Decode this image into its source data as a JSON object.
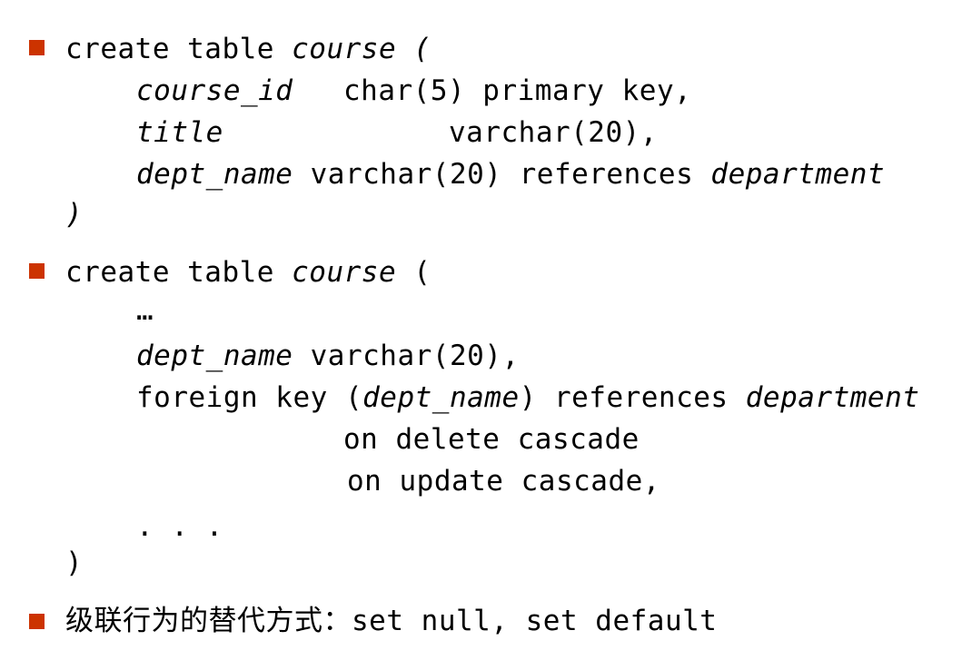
{
  "colors": {
    "bullet": "#cc3300",
    "text": "#000000"
  },
  "block1": {
    "kw": "create table ",
    "table": "course",
    "open": " (",
    "l1_col": "course_id",
    "l1_type": "char(5) primary key,",
    "l2_col": "title",
    "l2_type": "varchar(20),",
    "l3_col": "dept_name",
    "l3_type": " varchar(20) references ",
    "l3_ref": "department",
    "close": ")"
  },
  "block2": {
    "kw": "create table ",
    "table": "course",
    "open": " (",
    "ellipsis": "…",
    "col": "dept_name",
    "col_type": " varchar(20),",
    "fk_kw": "foreign key (",
    "fk_col": "dept_name",
    "fk_ref_kw": ") references ",
    "fk_ref": "department",
    "on_delete": "on delete cascade",
    "on_update": "on update cascade,",
    "dots": ". . .",
    "close": ")"
  },
  "block3": {
    "text": "级联行为的替代方式：set null, set default"
  }
}
